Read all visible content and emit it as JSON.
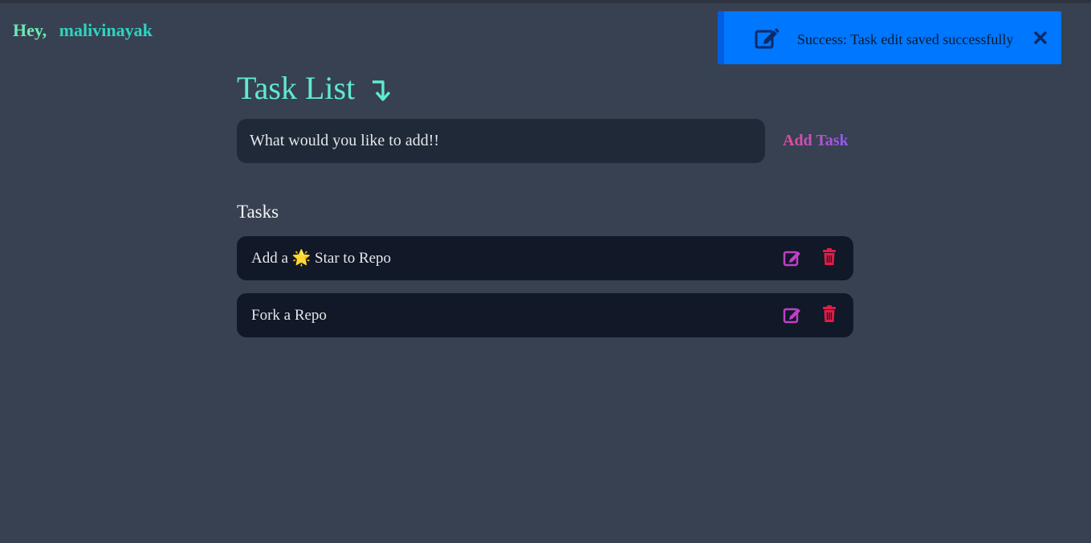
{
  "greeting": {
    "hey": "Hey,",
    "username": "malivinayak"
  },
  "toast": {
    "message": "Success: Task edit saved successfully",
    "icon": "edit-icon",
    "close_icon": "close-icon",
    "color": "#0077ff"
  },
  "header": {
    "title": "Task List",
    "arrow_icon": "arrow-down-icon",
    "title_color": "#5eead4"
  },
  "new_task": {
    "placeholder": "What would you like to add!!",
    "value": "",
    "add_label": "Add Task"
  },
  "tasks_section": {
    "heading": "Tasks",
    "items": [
      {
        "text": "Add a 🌟 Star to Repo",
        "edit_icon": "edit-icon",
        "delete_icon": "trash-icon"
      },
      {
        "text": "Fork a Repo",
        "edit_icon": "edit-icon",
        "delete_icon": "trash-icon"
      }
    ]
  },
  "colors": {
    "background": "#374151",
    "input_bg": "#1f2937",
    "task_bg": "#111827",
    "edit_color": "#c040c8",
    "delete_color": "#e11d48"
  }
}
